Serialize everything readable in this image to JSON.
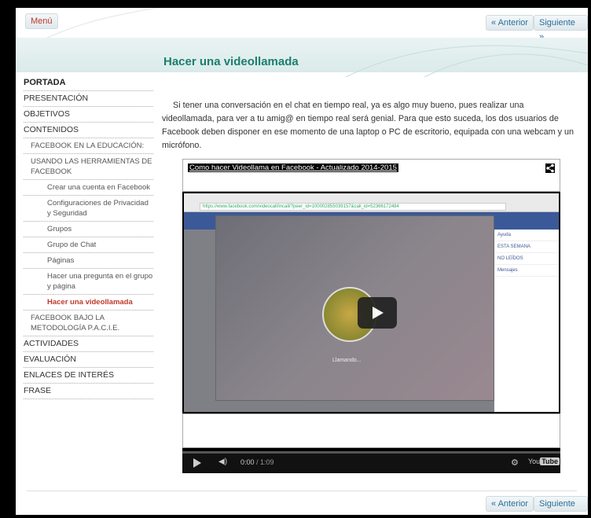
{
  "topbar": {
    "menu_label": "Menú",
    "prev_label": "« Anterior",
    "next_label": "Siguiente »"
  },
  "page": {
    "title": "Hacer una videollamada",
    "paragraph": "Si tener una conversación en el chat en tiempo real, ya es algo muy bueno, pues realizar una videollamada, para ver a tu amig@ en tiempo real será genial. Para que esto suceda, los dos usuarios de Facebook deben disponer en ese momento de una laptop o PC de escritorio, equipada con una webcam y un micrófono."
  },
  "sidebar": {
    "items": [
      {
        "label": "PORTADA"
      },
      {
        "label": "PRESENTACIÓN"
      },
      {
        "label": "OBJETIVOS"
      },
      {
        "label": "CONTENIDOS"
      },
      {
        "label": "FACEBOOK EN LA EDUCACIÓN:"
      },
      {
        "label": "USANDO LAS HERRAMIENTAS DE FACEBOOK"
      },
      {
        "label": "Crear una cuenta en Facebook"
      },
      {
        "label": "Configuraciones de Privacidad y Seguridad"
      },
      {
        "label": "Grupos"
      },
      {
        "label": "Grupo de Chat"
      },
      {
        "label": "Páginas"
      },
      {
        "label": "Hacer una pregunta en el grupo y página"
      },
      {
        "label": "Hacer una videollamada"
      },
      {
        "label": "FACEBOOK BAJO LA METODOLOGÍA P.A.C.I.E."
      },
      {
        "label": "ACTIVIDADES"
      },
      {
        "label": "EVALUACIÓN"
      },
      {
        "label": "ENLACES DE INTERÉS"
      },
      {
        "label": "FRASE"
      }
    ]
  },
  "video": {
    "title": "Como hacer Videollama en Facebook - Actualizado 2014-2015",
    "browser_url": "https://www.facebook.com/videocall/incall/?peer_id=100002855039157&call_id=52366172484",
    "calling_text": "Llamando...",
    "panel_items": [
      "Ayuda",
      "ESTA SEMANA",
      "NO LEÍDOS",
      "Mensajes"
    ],
    "current_time": "0:00",
    "duration": "/ 1:09",
    "logo_text": "You",
    "logo_tube": "Tube",
    "progress": 0
  }
}
